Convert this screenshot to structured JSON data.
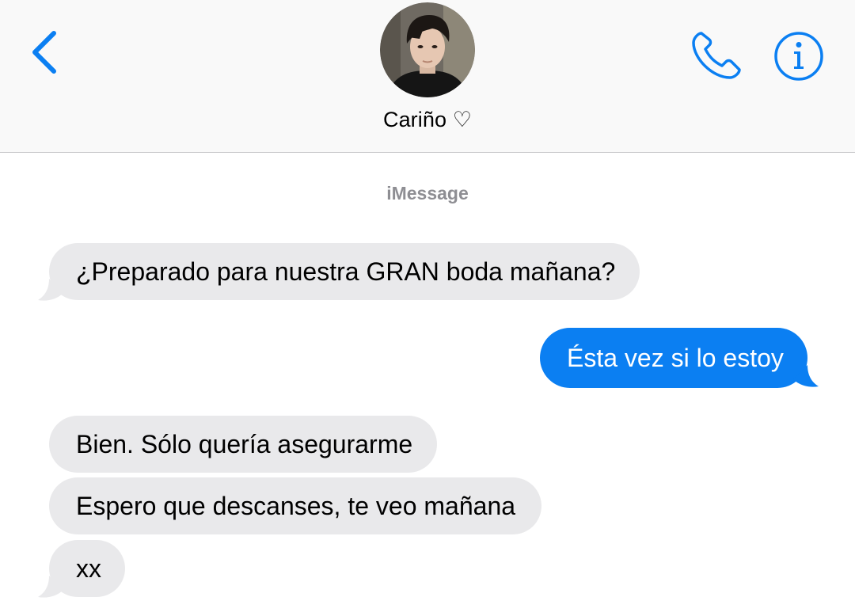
{
  "header": {
    "contact_name": "Cariño ♡",
    "back_icon": "chevron-left-icon",
    "call_icon": "phone-icon",
    "info_icon": "info-icon",
    "accent_color": "#0b7ff2"
  },
  "conversation": {
    "service_label": "iMessage",
    "messages": [
      {
        "direction": "incoming",
        "text": "¿Preparado para nuestra GRAN boda mañana?"
      },
      {
        "direction": "outgoing",
        "text": "Ésta vez si lo estoy"
      },
      {
        "direction": "incoming",
        "text": "Bien. Sólo quería asegurarme"
      },
      {
        "direction": "incoming",
        "text": "Espero que descanses, te veo mañana"
      },
      {
        "direction": "incoming",
        "text": "xx"
      }
    ]
  },
  "colors": {
    "incoming_bubble": "#e9e9eb",
    "outgoing_bubble": "#0b7ff2",
    "header_background": "#f9f9f9",
    "service_label": "#8e8e93"
  }
}
